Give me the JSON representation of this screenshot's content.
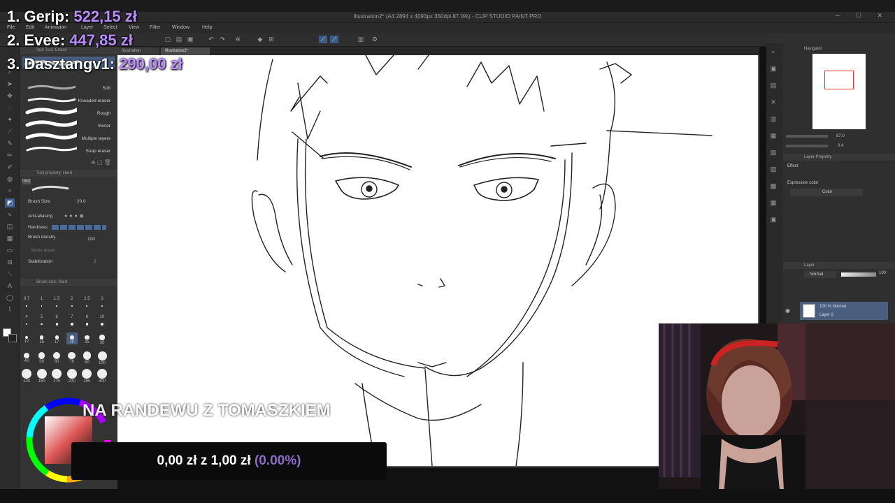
{
  "window": {
    "title": "Illustration2* (A4 2894 x 4093px 350dpi 87.0%) - CLIP STUDIO PAINT PRO",
    "controls": "─ ☐ ✕"
  },
  "menu": [
    "File",
    "Edit",
    "Animation",
    "Layer",
    "Select",
    "View",
    "Filter",
    "Window",
    "Help"
  ],
  "doc_tabs": [
    "Illustration",
    "Illustration2*"
  ],
  "sub_tool": {
    "header": "Sub Tool: Eraser",
    "brushes": [
      {
        "name": "Soft"
      },
      {
        "name": "Kneaded eraser"
      },
      {
        "name": "Rough"
      },
      {
        "name": "Vector"
      },
      {
        "name": "Multiple layers"
      },
      {
        "name": "Snap eraser"
      }
    ]
  },
  "tool_property": {
    "header": "Tool property: Hard",
    "preset": "Hard",
    "brush_size_label": "Brush Size",
    "brush_size_value": "20.0",
    "anti_aliasing_label": "Anti-aliasing",
    "hardness_label": "Hardness",
    "brush_density_label": "Brush density",
    "brush_density_value": "100",
    "vector_eraser_label": "Vector eraser",
    "stabilization_label": "Stabilization",
    "stabilization_value": "2"
  },
  "brush_size_panel": {
    "header": "Brush size: Hard",
    "sizes": [
      "0.7",
      "1",
      "1.5",
      "2",
      "2.5",
      "3",
      "4",
      "5",
      "6",
      "7",
      "8",
      "10",
      "12",
      "15",
      "17",
      "20",
      "25",
      "30",
      "40",
      "50",
      "60",
      "70",
      "80",
      "100",
      "120",
      "150",
      "170",
      "200",
      "250",
      "300"
    ],
    "selected": "20"
  },
  "navigator": {
    "title": "Navigator",
    "zoom": "87.0",
    "angle": "0.4"
  },
  "layer_property": {
    "title": "Layer Property",
    "effect_label": "Effect",
    "expression_label": "Expression color",
    "expression_value": "Color"
  },
  "layer_panel": {
    "title": "Layer",
    "blend": "Normal",
    "opacity": "100",
    "layer_opacity_mode": "100 % Normal",
    "layer_name": "Layer 2"
  },
  "overlay": {
    "top_donors": [
      {
        "rank": "1. Gerip:",
        "amount": "522,15 zł"
      },
      {
        "rank": "2. Evee:",
        "amount": "447,85 zł"
      },
      {
        "rank": "3. Dasztangv1:",
        "amount": "290,00 zł"
      }
    ],
    "banner": "NA RANDEWU Z TOMASZKIEM",
    "goal_main": "0,00 zł z 1,00 zł",
    "goal_pct": "(0.00%)"
  },
  "colors": {
    "accent": "#3d5b86",
    "donation": "#b98cff",
    "goal_pct": "#8c6cc7"
  }
}
